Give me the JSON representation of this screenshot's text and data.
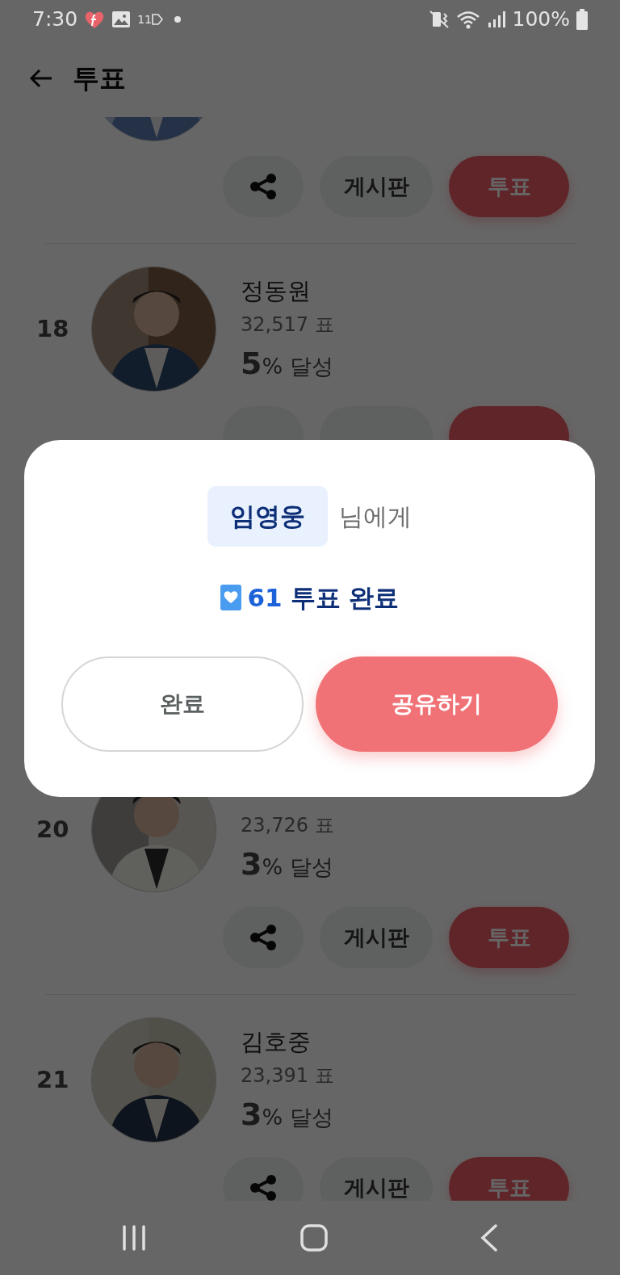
{
  "status_bar": {
    "time": "7:30",
    "tag_badge": "11",
    "battery": "100%"
  },
  "header": {
    "title": "투표"
  },
  "candidates": [
    {
      "board_label": "게시판",
      "vote_label": "투표"
    },
    {
      "rank": "18",
      "name": "정동원",
      "votes": "32,517 표",
      "percent": "5",
      "percent_suffix": "% 달성"
    },
    {
      "rank": "20",
      "votes": "23,726 표",
      "percent": "3",
      "percent_suffix": "% 달성",
      "board_label": "게시판",
      "vote_label": "투표"
    },
    {
      "rank": "21",
      "name": "김호중",
      "votes": "23,391 표",
      "percent": "3",
      "percent_suffix": "% 달성",
      "board_label": "게시판",
      "vote_label": "투표"
    }
  ],
  "dialog": {
    "name": "임영웅",
    "suffix": "님에게",
    "count": "61",
    "message": "투표 완료",
    "buttons": [
      {
        "label": "완료",
        "kind": "outline"
      },
      {
        "label": "공유하기",
        "kind": "primary"
      }
    ]
  }
}
